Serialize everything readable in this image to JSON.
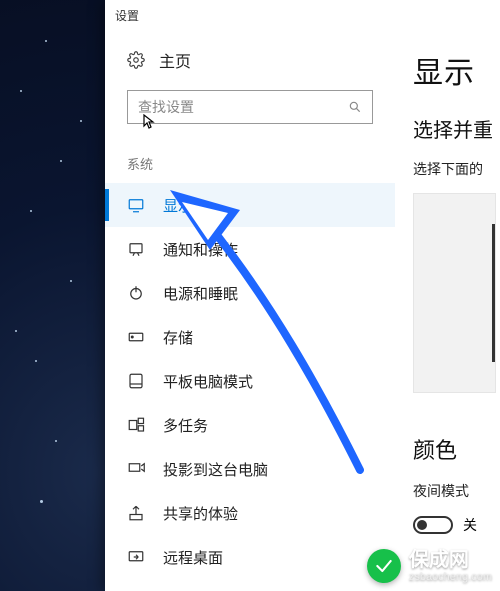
{
  "window_title": "设置",
  "home_label": "主页",
  "search_placeholder": "查找设置",
  "section_label": "系统",
  "nav": [
    {
      "label": "显示"
    },
    {
      "label": "通知和操作"
    },
    {
      "label": "电源和睡眠"
    },
    {
      "label": "存储"
    },
    {
      "label": "平板电脑模式"
    },
    {
      "label": "多任务"
    },
    {
      "label": "投影到这台电脑"
    },
    {
      "label": "共享的体验"
    },
    {
      "label": "远程桌面"
    }
  ],
  "panel": {
    "title": "显示",
    "rearrange_heading": "选择并重",
    "rearrange_hint": "选择下面的",
    "color_heading": "颜色",
    "night_light_label": "夜间模式",
    "toggle_off_label": "关"
  },
  "watermark": {
    "brand": "保成网",
    "url": "zsbaocheng.com"
  }
}
